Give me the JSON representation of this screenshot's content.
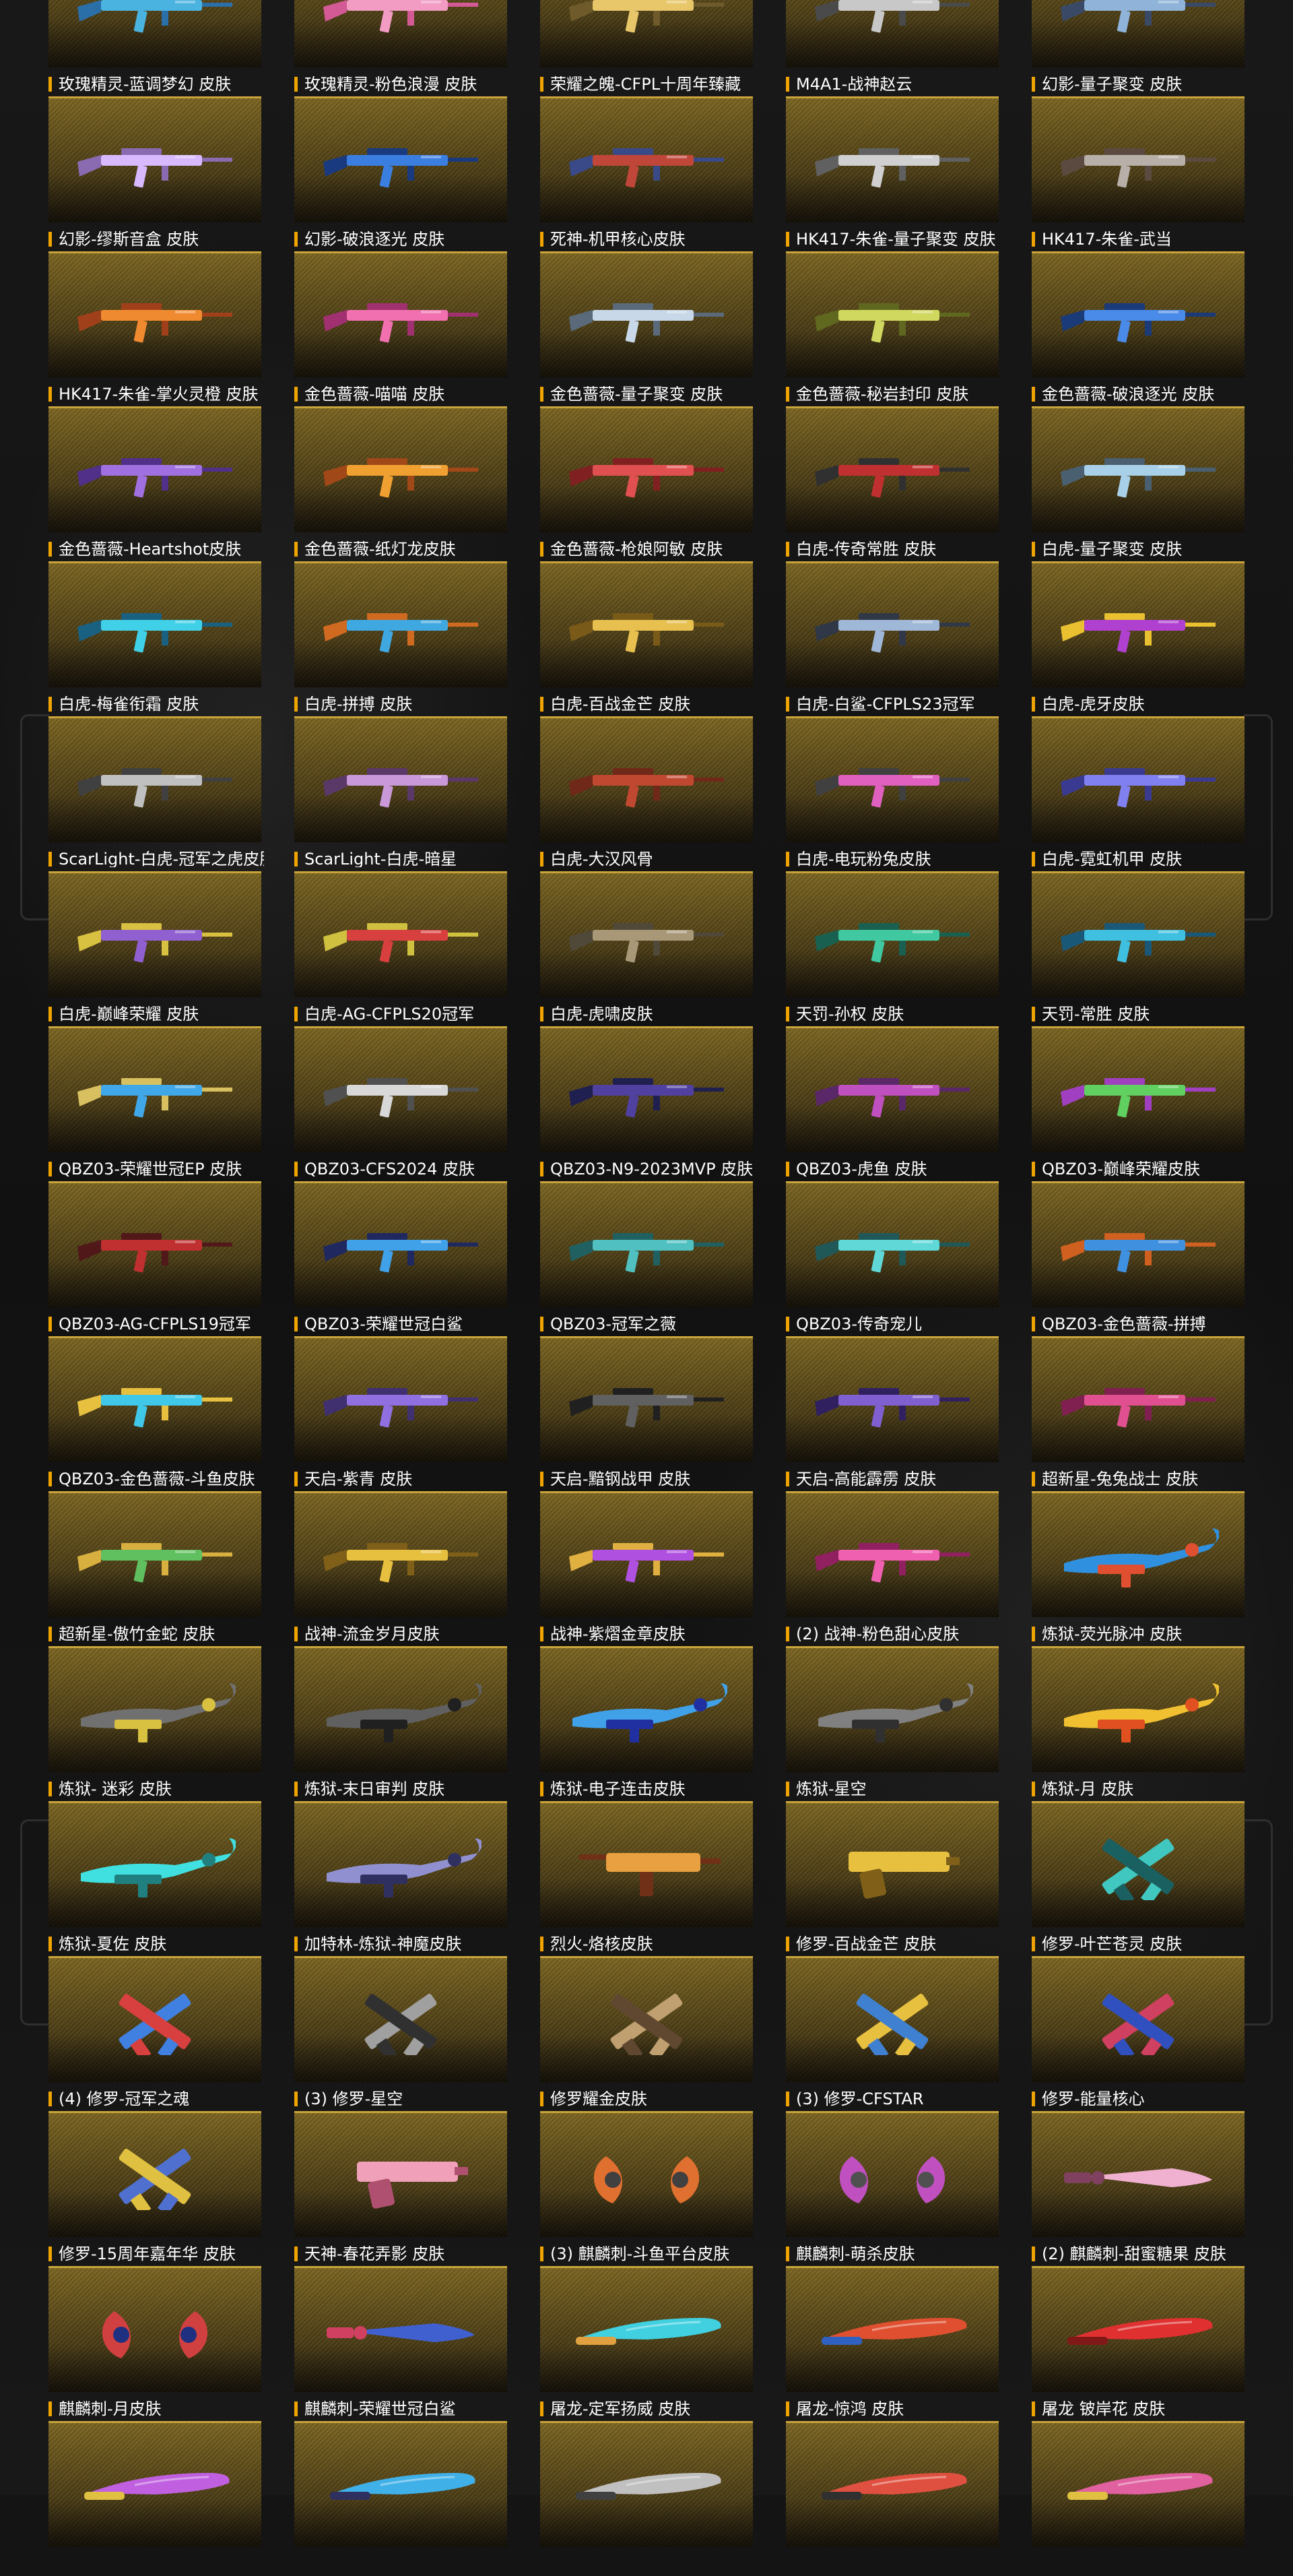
{
  "theme": {
    "accent": "#f0a400",
    "card_top": "#7a6420",
    "card_bottom": "#2a2110",
    "background": "#141414"
  },
  "skins": [
    {
      "label": "玫瑰精灵-蓝调梦幻 皮肤",
      "colors": [
        "#4ab3e0",
        "#2a6fa8"
      ],
      "icon": "rifle-icon"
    },
    {
      "label": "玫瑰精灵-粉色浪漫 皮肤",
      "colors": [
        "#f29cc4",
        "#d45a95"
      ],
      "icon": "rifle-icon"
    },
    {
      "label": "荣耀之魄-CFPL十周年臻藏",
      "colors": [
        "#e8c76a",
        "#6e5a2a"
      ],
      "icon": "rifle-icon"
    },
    {
      "label": "M4A1-战神赵云",
      "colors": [
        "#c8c8c8",
        "#4a4a4a"
      ],
      "icon": "rifle-icon"
    },
    {
      "label": "幻影-量子聚变 皮肤",
      "colors": [
        "#8fb3d9",
        "#3a4a66"
      ],
      "icon": "rifle-icon"
    },
    {
      "label": "幻影-缪斯音盒 皮肤",
      "colors": [
        "#d8b8ff",
        "#8a6ab0"
      ],
      "icon": "rifle-icon"
    },
    {
      "label": "幻影-破浪逐光 皮肤",
      "colors": [
        "#3a7fe0",
        "#1a3a80"
      ],
      "icon": "rifle-icon"
    },
    {
      "label": "死神-机甲核心皮肤",
      "colors": [
        "#c0463a",
        "#3a4a88"
      ],
      "icon": "rifle-icon"
    },
    {
      "label": "HK417-朱雀-量子聚变 皮肤",
      "colors": [
        "#d0d0d0",
        "#606060"
      ],
      "icon": "rifle-icon"
    },
    {
      "label": "HK417-朱雀-武当",
      "colors": [
        "#b8b0a8",
        "#5a4a40"
      ],
      "icon": "rifle-icon"
    },
    {
      "label": "HK417-朱雀-掌火灵橙 皮肤",
      "colors": [
        "#f08a30",
        "#a0401a"
      ],
      "icon": "rifle-icon"
    },
    {
      "label": "金色蔷薇-喵喵 皮肤",
      "colors": [
        "#f070b0",
        "#a03070"
      ],
      "icon": "rifle-icon"
    },
    {
      "label": "金色蔷薇-量子聚变 皮肤",
      "colors": [
        "#c8d8e8",
        "#5a6a7a"
      ],
      "icon": "rifle-icon"
    },
    {
      "label": "金色蔷薇-秘岩封印 皮肤",
      "colors": [
        "#d0d860",
        "#606820"
      ],
      "icon": "rifle-icon"
    },
    {
      "label": "金色蔷薇-破浪逐光 皮肤",
      "colors": [
        "#4a8ae8",
        "#1a3a78"
      ],
      "icon": "rifle-icon"
    },
    {
      "label": "金色蔷薇-Heartshot皮肤",
      "colors": [
        "#a070e0",
        "#503088"
      ],
      "icon": "rifle-icon"
    },
    {
      "label": "金色蔷薇-纸灯龙皮肤",
      "colors": [
        "#f0a030",
        "#a04818"
      ],
      "icon": "rifle-icon"
    },
    {
      "label": "金色蔷薇-枪娘阿敏 皮肤",
      "colors": [
        "#e05050",
        "#802020"
      ],
      "icon": "rifle-icon"
    },
    {
      "label": "白虎-传奇常胜 皮肤",
      "colors": [
        "#c03030",
        "#303030"
      ],
      "icon": "rifle-icon"
    },
    {
      "label": "白虎-量子聚变 皮肤",
      "colors": [
        "#a8d0e8",
        "#4a6070"
      ],
      "icon": "rifle-icon"
    },
    {
      "label": "白虎-梅雀衔霜 皮肤",
      "colors": [
        "#40d0e8",
        "#1a6080"
      ],
      "icon": "rifle-icon"
    },
    {
      "label": "白虎-拼搏 皮肤",
      "colors": [
        "#40a8e0",
        "#d06a20"
      ],
      "icon": "rifle-icon"
    },
    {
      "label": "白虎-百战金芒 皮肤",
      "colors": [
        "#e8c050",
        "#7a5a18"
      ],
      "icon": "rifle-icon"
    },
    {
      "label": "白虎-白鲨-CFPLS23冠军",
      "colors": [
        "#a0b8d8",
        "#303848"
      ],
      "icon": "rifle-icon"
    },
    {
      "label": "白虎-虎牙皮肤",
      "colors": [
        "#b040d0",
        "#e8c030"
      ],
      "icon": "rifle-icon"
    },
    {
      "label": "ScarLight-白虎-冠军之虎皮肤",
      "colors": [
        "#c0c0c0",
        "#404040"
      ],
      "icon": "rifle-icon"
    },
    {
      "label": "ScarLight-白虎-暗星",
      "colors": [
        "#c898d8",
        "#5a3868"
      ],
      "icon": "rifle-icon"
    },
    {
      "label": "白虎-大汉风骨",
      "colors": [
        "#c04830",
        "#702818"
      ],
      "icon": "rifle-icon"
    },
    {
      "label": "白虎-电玩粉兔皮肤",
      "colors": [
        "#e060c0",
        "#404040"
      ],
      "icon": "rifle-icon"
    },
    {
      "label": "白虎-霓虹机甲 皮肤",
      "colors": [
        "#8080f0",
        "#3a3a90"
      ],
      "icon": "rifle-icon"
    },
    {
      "label": "白虎-巅峰荣耀 皮肤",
      "colors": [
        "#9060d0",
        "#d8c040"
      ],
      "icon": "rifle-icon"
    },
    {
      "label": "白虎-AG-CFPLS20冠军",
      "colors": [
        "#d84040",
        "#d0c040"
      ],
      "icon": "rifle-icon"
    },
    {
      "label": "白虎-虎啸皮肤",
      "colors": [
        "#a89878",
        "#504838"
      ],
      "icon": "rifle-icon"
    },
    {
      "label": "天罚-孙权 皮肤",
      "colors": [
        "#40c8a0",
        "#1a6050"
      ],
      "icon": "rifle-icon"
    },
    {
      "label": "天罚-常胜 皮肤",
      "colors": [
        "#40c0e0",
        "#1a5878"
      ],
      "icon": "rifle-icon"
    },
    {
      "label": "QBZ03-荣耀世冠EP 皮肤",
      "colors": [
        "#40a8e8",
        "#d8c060"
      ],
      "icon": "rifle-icon"
    },
    {
      "label": "QBZ03-CFS2024 皮肤",
      "colors": [
        "#d8d8d8",
        "#505050"
      ],
      "icon": "rifle-icon"
    },
    {
      "label": "QBZ03-N9-2023MVP 皮肤",
      "colors": [
        "#5040a0",
        "#202050"
      ],
      "icon": "rifle-icon"
    },
    {
      "label": "QBZ03-虎鱼 皮肤",
      "colors": [
        "#c050c0",
        "#5a2868"
      ],
      "icon": "rifle-icon"
    },
    {
      "label": "QBZ03-巅峰荣耀皮肤",
      "colors": [
        "#60d060",
        "#a040c0"
      ],
      "icon": "rifle-icon"
    },
    {
      "label": "QBZ03-AG-CFPLS19冠军",
      "colors": [
        "#c03030",
        "#501818"
      ],
      "icon": "rifle-icon"
    },
    {
      "label": "QBZ03-荣耀世冠白鲨",
      "colors": [
        "#40a0e8",
        "#202860"
      ],
      "icon": "rifle-icon"
    },
    {
      "label": "QBZ03-冠军之薇",
      "colors": [
        "#50c0c0",
        "#206060"
      ],
      "icon": "rifle-icon"
    },
    {
      "label": "QBZ03-传奇宠儿",
      "colors": [
        "#60d8d8",
        "#205858"
      ],
      "icon": "rifle-icon"
    },
    {
      "label": "QBZ03-金色蔷薇-拼搏",
      "colors": [
        "#4090e0",
        "#d06020"
      ],
      "icon": "rifle-icon"
    },
    {
      "label": "QBZ03-金色蔷薇-斗鱼皮肤",
      "colors": [
        "#40c8e8",
        "#e8c040"
      ],
      "icon": "rifle-icon"
    },
    {
      "label": "天启-紫青 皮肤",
      "colors": [
        "#9070e0",
        "#403070"
      ],
      "icon": "rifle-icon"
    },
    {
      "label": "天启-黯钢战甲 皮肤",
      "colors": [
        "#606060",
        "#202020"
      ],
      "icon": "rifle-icon"
    },
    {
      "label": "天启-高能霹雳 皮肤",
      "colors": [
        "#8060d0",
        "#302060"
      ],
      "icon": "rifle-icon"
    },
    {
      "label": "超新星-兔兔战士 皮肤",
      "colors": [
        "#e05090",
        "#802050"
      ],
      "icon": "rifle-icon"
    },
    {
      "label": "超新星-傲竹金蛇 皮肤",
      "colors": [
        "#60c060",
        "#d8b040"
      ],
      "icon": "rifle-icon"
    },
    {
      "label": "战神-流金岁月皮肤",
      "colors": [
        "#e8c040",
        "#806018"
      ],
      "icon": "rifle-icon"
    },
    {
      "label": "战神-紫熠金章皮肤",
      "colors": [
        "#b050e0",
        "#e0b040"
      ],
      "icon": "rifle-icon"
    },
    {
      "label": "(2) 战神-粉色甜心皮肤",
      "colors": [
        "#f060b0",
        "#902060"
      ],
      "icon": "rifle-icon"
    },
    {
      "label": "炼狱-荧光脉冲 皮肤",
      "colors": [
        "#3090e0",
        "#e05030"
      ],
      "icon": "heavy-icon"
    },
    {
      "label": "炼狱- 迷彩 皮肤",
      "colors": [
        "#707070",
        "#d8c040"
      ],
      "icon": "heavy-icon"
    },
    {
      "label": "炼狱-末日审判 皮肤",
      "colors": [
        "#606060",
        "#202020"
      ],
      "icon": "heavy-icon"
    },
    {
      "label": "炼狱-电子连击皮肤",
      "colors": [
        "#40a0e8",
        "#2030a0"
      ],
      "icon": "heavy-icon"
    },
    {
      "label": "炼狱-星空",
      "colors": [
        "#808080",
        "#303030"
      ],
      "icon": "heavy-icon"
    },
    {
      "label": "炼狱-月 皮肤",
      "colors": [
        "#f0c030",
        "#e05020"
      ],
      "icon": "heavy-icon"
    },
    {
      "label": "炼狱-夏佐 皮肤",
      "colors": [
        "#40e0e0",
        "#208080"
      ],
      "icon": "heavy-icon"
    },
    {
      "label": "加特林-炼狱-神魔皮肤",
      "colors": [
        "#9090d0",
        "#303060"
      ],
      "icon": "heavy-icon"
    },
    {
      "label": "烈火-烙核皮肤",
      "colors": [
        "#e8a040",
        "#703018"
      ],
      "icon": "smg-icon"
    },
    {
      "label": "修罗-百战金芒 皮肤",
      "colors": [
        "#e8c040",
        "#806018"
      ],
      "icon": "pistol-icon"
    },
    {
      "label": "修罗-叶芒苍灵 皮肤",
      "colors": [
        "#40c8c0",
        "#1a6060"
      ],
      "icon": "dual-icon"
    },
    {
      "label": "(4) 修罗-冠军之魂",
      "colors": [
        "#4080e0",
        "#d84040"
      ],
      "icon": "dual-icon"
    },
    {
      "label": "(3) 修罗-星空",
      "colors": [
        "#a0a0a0",
        "#303030"
      ],
      "icon": "dual-icon"
    },
    {
      "label": "修罗耀金皮肤",
      "colors": [
        "#c0a070",
        "#604830"
      ],
      "icon": "dual-icon"
    },
    {
      "label": "(3) 修罗-CFSTAR",
      "colors": [
        "#e8c040",
        "#4080d0"
      ],
      "icon": "dual-icon"
    },
    {
      "label": "修罗-能量核心",
      "colors": [
        "#d04060",
        "#3050c0"
      ],
      "icon": "dual-icon"
    },
    {
      "label": "修罗-15周年嘉年华 皮肤",
      "colors": [
        "#5070d0",
        "#e0c040"
      ],
      "icon": "dual-icon"
    },
    {
      "label": "天神-春花弄影 皮肤",
      "colors": [
        "#f0a0b8",
        "#b05070"
      ],
      "icon": "pistol-icon"
    },
    {
      "label": "(3) 麒麟刺-斗鱼平台皮肤",
      "colors": [
        "#e07030",
        "#404040"
      ],
      "icon": "claw-icon"
    },
    {
      "label": "麒麟刺-萌杀皮肤",
      "colors": [
        "#c050c0",
        "#505050"
      ],
      "icon": "claw-icon"
    },
    {
      "label": "(2) 麒麟刺-甜蜜糖果 皮肤",
      "colors": [
        "#f0b0d0",
        "#804060"
      ],
      "icon": "knife-icon"
    },
    {
      "label": "麒麟刺-月皮肤",
      "colors": [
        "#d04040",
        "#203080"
      ],
      "icon": "claw-icon"
    },
    {
      "label": "麒麟刺-荣耀世冠白鲨",
      "colors": [
        "#4060d0",
        "#d04060"
      ],
      "icon": "knife-icon"
    },
    {
      "label": "屠龙-定军扬威 皮肤",
      "colors": [
        "#40d0e0",
        "#e0a040"
      ],
      "icon": "blade-icon"
    },
    {
      "label": "屠龙-惊鸿 皮肤",
      "colors": [
        "#e05030",
        "#3060c0"
      ],
      "icon": "blade-icon"
    },
    {
      "label": "屠龙 铍岸花 皮肤",
      "colors": [
        "#e03030",
        "#801818"
      ],
      "icon": "blade-icon"
    },
    {
      "label": "",
      "colors": [
        "#c060e0",
        "#e0c040"
      ],
      "icon": "blade-icon"
    },
    {
      "label": "",
      "colors": [
        "#40b0e8",
        "#303060"
      ],
      "icon": "blade-icon"
    },
    {
      "label": "",
      "colors": [
        "#c0c0c0",
        "#404040"
      ],
      "icon": "blade-icon"
    },
    {
      "label": "",
      "colors": [
        "#e05040",
        "#303030"
      ],
      "icon": "blade-icon"
    },
    {
      "label": "",
      "colors": [
        "#e060a0",
        "#e0c040"
      ],
      "icon": "blade-icon"
    }
  ]
}
